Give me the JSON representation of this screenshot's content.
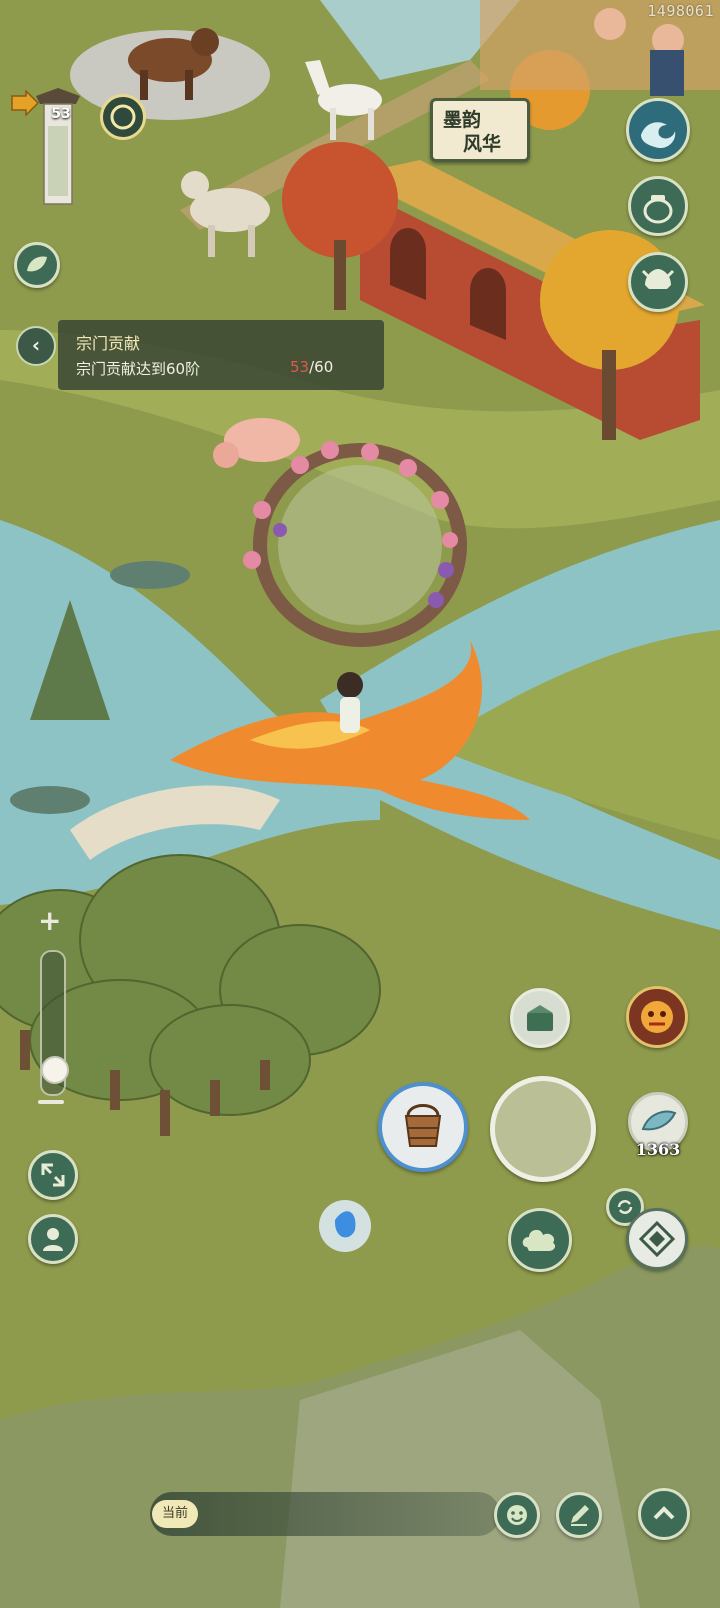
{
  "user_id_text": "1498061",
  "level": {
    "value": "53"
  },
  "banner": {
    "line1": "墨韵",
    "line2": "风华"
  },
  "quest": {
    "title": "宗门贡献",
    "description": "宗门贡献达到60阶",
    "current": "53",
    "total": "/60"
  },
  "zoom": {
    "plus_label": "+",
    "level": 0.1
  },
  "resource_count": "1363",
  "chat": {
    "channel_label": "当前"
  },
  "icons": {
    "quest_back": "chevron-left-icon",
    "wave_badge": "wave-icon",
    "pot": "pot-icon",
    "helmet": "helmet-icon",
    "chest": "chest-icon",
    "lion_mask": "lion-mask-icon",
    "bucket": "bucket-icon",
    "leaf": "leaf-icon",
    "cloud": "cloud-icon",
    "compass": "compass-icon",
    "refresh": "refresh-icon",
    "expand": "expand-icon",
    "person": "person-icon",
    "emoji": "smile-icon",
    "edit": "edit-icon",
    "up": "chevron-up-icon"
  },
  "colors": {
    "grass": "#8e9a4c",
    "river": "#8ec3c6",
    "button_green": "#3d6b55",
    "quest_progress_current": "#e2584f"
  }
}
